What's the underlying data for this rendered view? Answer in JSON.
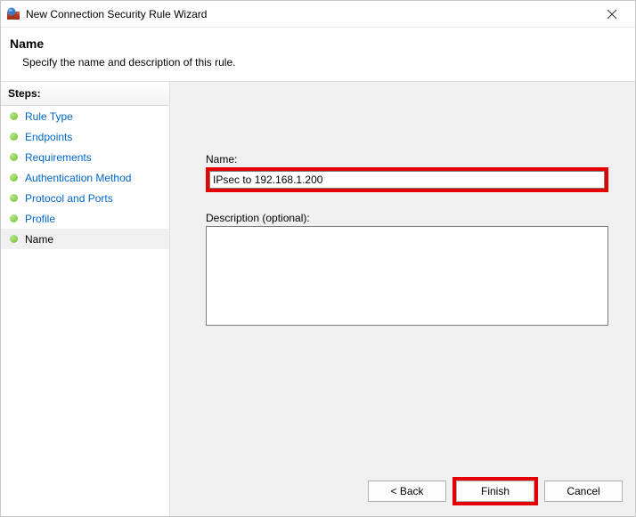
{
  "window": {
    "title": "New Connection Security Rule Wizard"
  },
  "header": {
    "title": "Name",
    "subtitle": "Specify the name and description of this rule."
  },
  "sidebar": {
    "header": "Steps:",
    "items": [
      {
        "label": "Rule Type",
        "current": false
      },
      {
        "label": "Endpoints",
        "current": false
      },
      {
        "label": "Requirements",
        "current": false
      },
      {
        "label": "Authentication Method",
        "current": false
      },
      {
        "label": "Protocol and Ports",
        "current": false
      },
      {
        "label": "Profile",
        "current": false
      },
      {
        "label": "Name",
        "current": true
      }
    ]
  },
  "form": {
    "name_label": "Name:",
    "name_value": "IPsec to 192.168.1.200",
    "desc_label": "Description (optional):",
    "desc_value": ""
  },
  "buttons": {
    "back": "< Back",
    "finish": "Finish",
    "cancel": "Cancel"
  }
}
